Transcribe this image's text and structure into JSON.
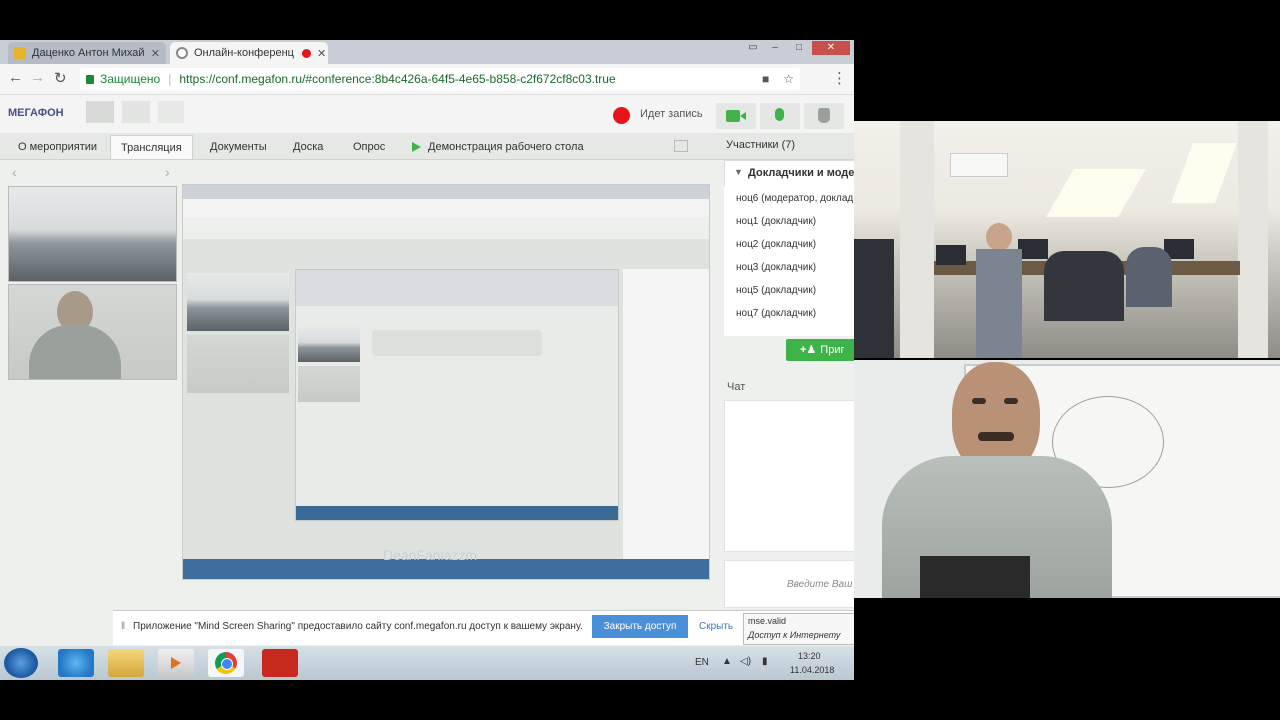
{
  "browser": {
    "tabs": [
      {
        "title": "Даценко Антон Михай",
        "close": "✕"
      },
      {
        "title": "Онлайн-конференц",
        "close": "✕"
      }
    ],
    "secure_label": "Защищено",
    "url": "https://conf.megafon.ru/#conference:8b4c426a-64f5-4e65-b858-c2f672cf8c03.true"
  },
  "app": {
    "brand": "МЕГАФОН",
    "record_label": "Идет запись",
    "tabs": [
      "О мероприятии",
      "Трансляция",
      "Документы",
      "Доска",
      "Опрос",
      "Демонстрация рабочего стола"
    ],
    "active_tab": "Трансляция",
    "participants_title": "Участники (7)",
    "speakers_title": "Докладчики и модера",
    "participants": [
      "ноц6 (модератор, доклад",
      "ноц1 (докладчик)",
      "ноц2 (докладчик)",
      "ноц3 (докладчик)",
      "ноц5 (докладчик)",
      "ноц7 (докладчик)"
    ],
    "invite_label": "Приг",
    "chat_title": "Чат",
    "chat_placeholder": "Введите Ваш",
    "watermark": "DeanFaniazzm"
  },
  "notification": {
    "text": "Приложение \"Mind Screen Sharing\" предоставило сайту conf.megafon.ru доступ к вашему экрану.",
    "stop_button": "Закрыть доступ",
    "hide_button": "Скрыть",
    "net_name": "mse.valid",
    "net_status": "Доступ к Интернету"
  },
  "taskbar": {
    "lang": "EN",
    "time": "13:20",
    "date": "11.04.2018"
  },
  "colors": {
    "green": "#3fb349",
    "record": "#e8141b",
    "blue_button": "#4a90d9"
  }
}
